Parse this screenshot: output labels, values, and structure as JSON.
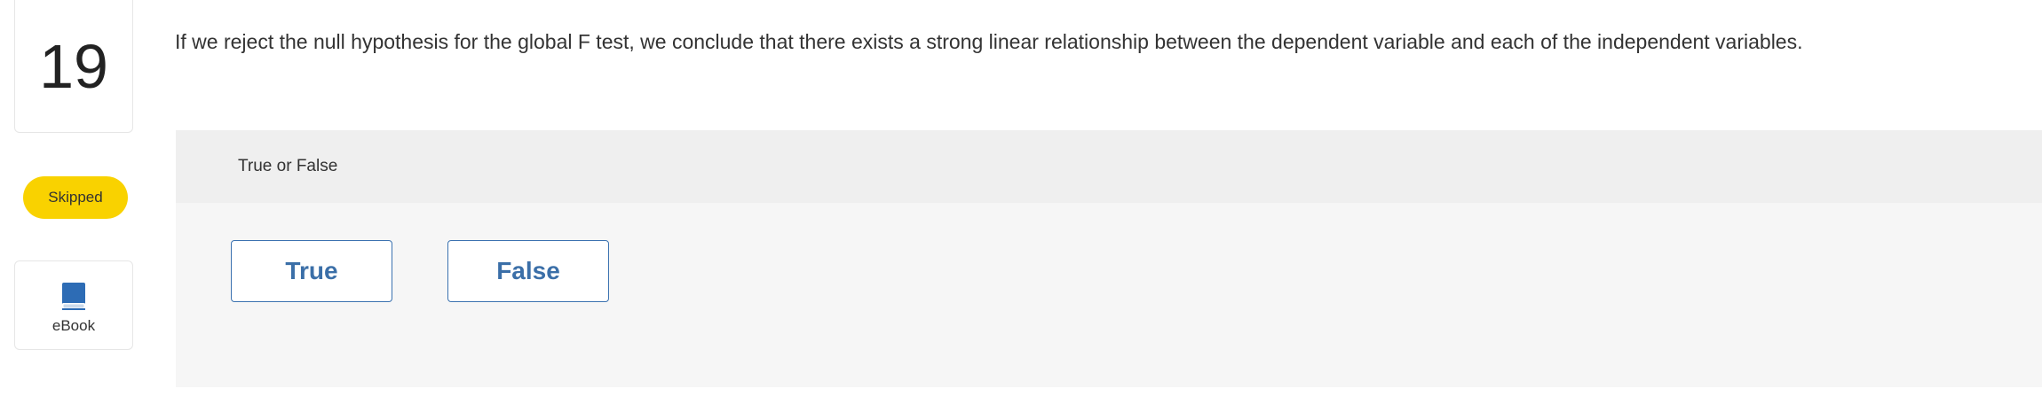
{
  "question": {
    "number": "19",
    "status": "Skipped",
    "text": "If we reject the null hypothesis for the global F test, we conclude that there exists a strong linear relationship between the dependent variable and each of the independent variables."
  },
  "resources": {
    "ebook_label": "eBook",
    "ebook_icon": "book-icon"
  },
  "answer": {
    "type_label": "True or False",
    "choices": [
      {
        "label": "True"
      },
      {
        "label": "False"
      }
    ]
  },
  "colors": {
    "status_badge": "#f9d200",
    "choice_border": "#3b72b0",
    "choice_text": "#3b6fa8",
    "ebook_icon": "#2d6cb5"
  }
}
